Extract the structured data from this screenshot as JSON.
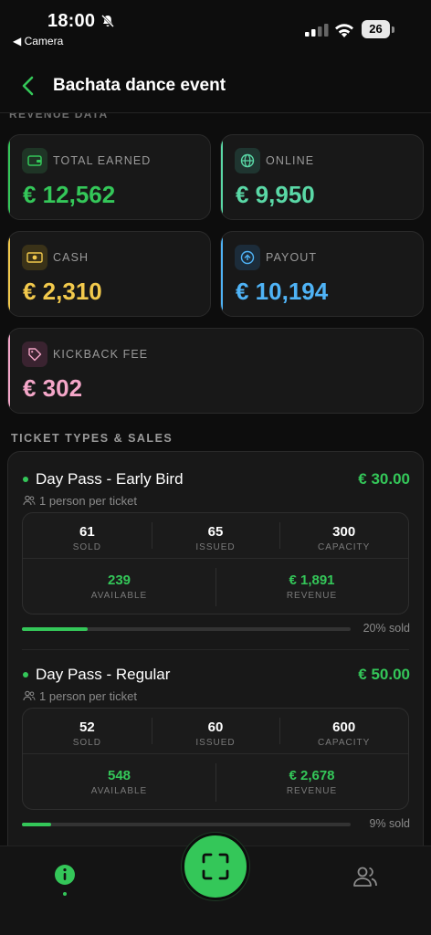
{
  "status_bar": {
    "time": "18:00",
    "back_app": "◀ Camera",
    "battery": "26"
  },
  "header": {
    "title": "Bachata dance event"
  },
  "revenue": {
    "section_label": "REVENUE DATA",
    "cards": [
      {
        "label": "TOTAL EARNED",
        "value": "€ 12,562",
        "accent": "#34c759",
        "icon": "wallet-icon"
      },
      {
        "label": "ONLINE",
        "value": "€ 9,950",
        "accent": "#5ad8a6",
        "icon": "globe-icon"
      },
      {
        "label": "CASH",
        "value": "€ 2,310",
        "accent": "#f2c94c",
        "icon": "banknote-icon"
      },
      {
        "label": "PAYOUT",
        "value": "€ 10,194",
        "accent": "#4fb3f6",
        "icon": "payout-icon"
      },
      {
        "label": "KICKBACK FEE",
        "value": "€ 302",
        "accent": "#f4a6c8",
        "icon": "tag-icon"
      }
    ]
  },
  "tickets": {
    "section_label": "TICKET TYPES & SALES",
    "items": [
      {
        "name": "Day Pass - Early Bird",
        "price": "€ 30.00",
        "per": "1 person per ticket",
        "sold": "61",
        "issued": "65",
        "capacity": "300",
        "available": "239",
        "revenue": "€ 1,891",
        "sold_pct": 20,
        "sold_label": "20% sold",
        "labels": {
          "sold": "SOLD",
          "issued": "ISSUED",
          "capacity": "CAPACITY",
          "available": "AVAILABLE",
          "revenue": "REVENUE"
        }
      },
      {
        "name": "Day Pass - Regular",
        "price": "€ 50.00",
        "per": "1 person per ticket",
        "sold": "52",
        "issued": "60",
        "capacity": "600",
        "available": "548",
        "revenue": "€ 2,678",
        "sold_pct": 9,
        "sold_label": "9% sold",
        "labels": {
          "sold": "SOLD",
          "issued": "ISSUED",
          "capacity": "CAPACITY",
          "available": "AVAILABLE",
          "revenue": "REVENUE"
        }
      }
    ]
  },
  "nav": {
    "info_icon": "info-icon",
    "scan_icon": "scan-icon",
    "people_icon": "people-icon"
  },
  "colors": {
    "accent": "#34c759",
    "background": "#0d0d0d",
    "card": "#181818"
  }
}
